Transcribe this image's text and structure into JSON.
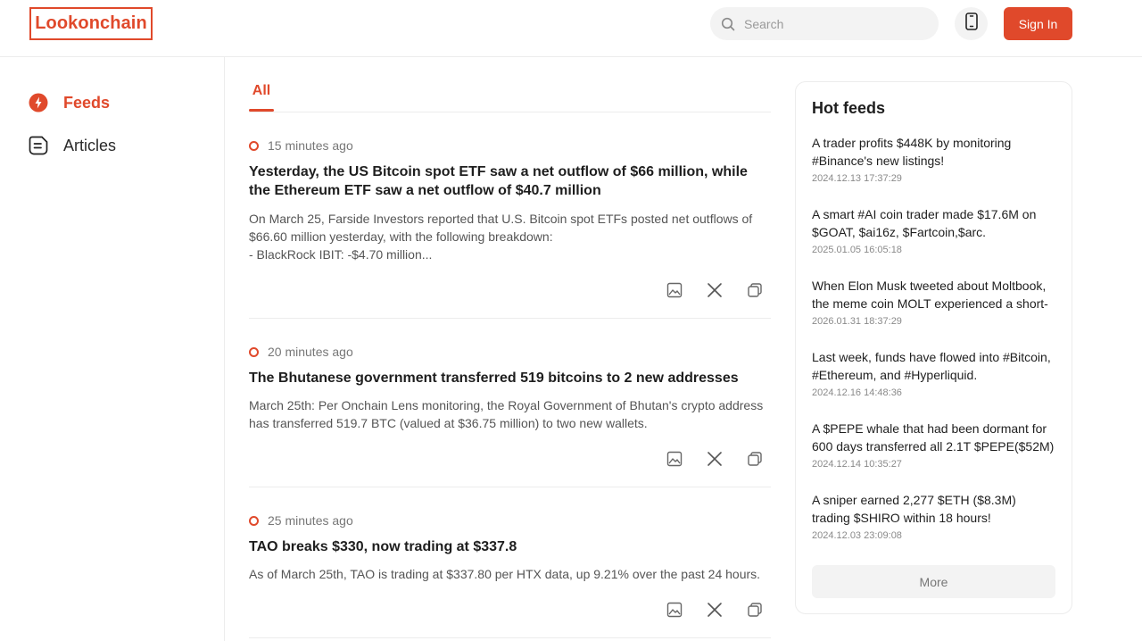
{
  "brand": {
    "logo_text": "Lookonchain",
    "accent": "#e0492b"
  },
  "header": {
    "search_placeholder": "Search",
    "signin_label": "Sign In"
  },
  "sidebar": {
    "items": [
      {
        "label": "Feeds",
        "icon": "lightning-icon",
        "active": true
      },
      {
        "label": "Articles",
        "icon": "document-icon",
        "active": false
      }
    ]
  },
  "tabs": [
    {
      "label": "All",
      "active": true
    }
  ],
  "feeds": [
    {
      "time": "15 minutes ago",
      "title": "Yesterday, the US Bitcoin spot ETF saw a net outflow of $66 million, while the Ethereum ETF saw a net outflow of $40.7 million",
      "body": "On March 25, Farside Investors reported that U.S. Bitcoin spot ETFs posted net outflows of $66.60 million yesterday, with the following breakdown:\n- BlackRock IBIT: -$4.70 million..."
    },
    {
      "time": "20 minutes ago",
      "title": "The Bhutanese government transferred 519 bitcoins to 2 new addresses",
      "body": "March 25th: Per Onchain Lens monitoring, the Royal Government of Bhutan's crypto address has transferred 519.7 BTC (valued at $36.75 million) to two new wallets."
    },
    {
      "time": "25 minutes ago",
      "title": "TAO breaks $330, now trading at $337.8",
      "body": "As of March 25th, TAO is trading at $337.80 per HTX data, up 9.21% over the past 24 hours."
    }
  ],
  "hot_feeds": {
    "title": "Hot feeds",
    "items": [
      {
        "text": "A trader profits $448K by monitoring #Binance's new listings!",
        "date": "2024.12.13 17:37:29"
      },
      {
        "text": "A smart #AI coin trader made $17.6M on $GOAT, $ai16z, $Fartcoin,$arc.",
        "date": "2025.01.05 16:05:18"
      },
      {
        "text": "When Elon Musk tweeted about Moltbook, the meme coin MOLT experienced a short-term...",
        "date": "2026.01.31 18:37:29"
      },
      {
        "text": "Last week, funds have flowed into #Bitcoin, #Ethereum, and #Hyperliquid.",
        "date": "2024.12.16 14:48:36"
      },
      {
        "text": "A $PEPE whale that had been dormant for 600 days transferred all 2.1T $PEPE($52M) ...",
        "date": "2024.12.14 10:35:27"
      },
      {
        "text": "A sniper earned 2,277 $ETH ($8.3M) trading $SHIRO within 18 hours!",
        "date": "2024.12.03 23:09:08"
      }
    ],
    "more_label": "More"
  }
}
